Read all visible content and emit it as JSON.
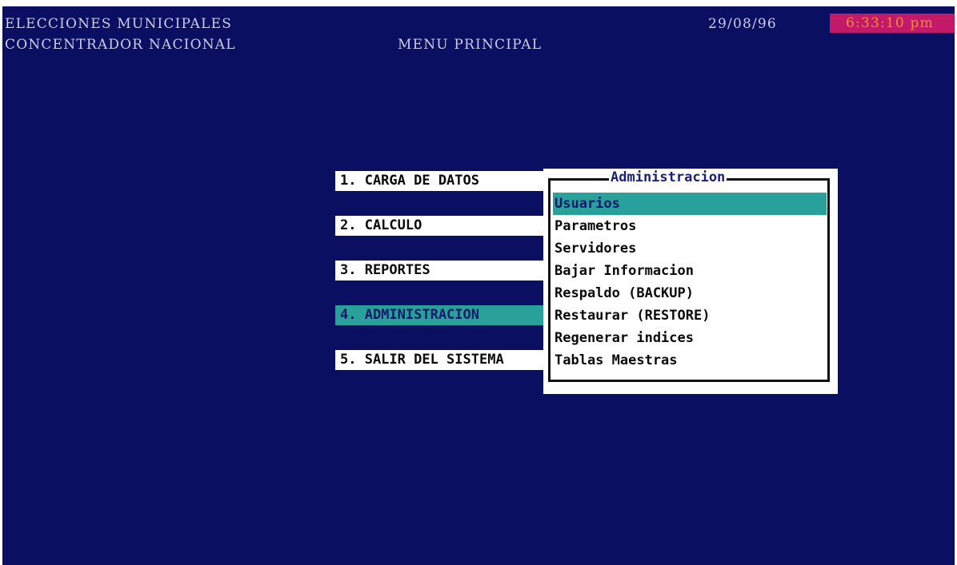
{
  "header": {
    "app_title": "ELECCIONES MUNICIPALES",
    "app_subtitle": "CONCENTRADOR NACIONAL",
    "menu_title": "MENU PRINCIPAL",
    "date": "29/08/96",
    "time": "6:33:10 pm"
  },
  "main_menu": {
    "selected_index": 3,
    "items": [
      {
        "label": "1. CARGA DE DATOS"
      },
      {
        "label": "2. CALCULO"
      },
      {
        "label": "3. REPORTES"
      },
      {
        "label": "4. ADMINISTRACION"
      },
      {
        "label": "5. SALIR DEL SISTEMA"
      }
    ]
  },
  "submenu": {
    "title": "Administracion",
    "selected_index": 0,
    "items": [
      {
        "label": "Usuarios"
      },
      {
        "label": "Parametros"
      },
      {
        "label": "Servidores"
      },
      {
        "label": "Bajar Informacion"
      },
      {
        "label": "Respaldo (BACKUP)"
      },
      {
        "label": "Restaurar (RESTORE)"
      },
      {
        "label": "Regenerar indices"
      },
      {
        "label": "Tablas Maestras"
      }
    ]
  },
  "colors": {
    "background": "#0a0f62",
    "highlight": "#2aa09a",
    "clock_bg": "#c21a68",
    "clock_text": "#f08a3c",
    "header_text": "#c9cde8"
  }
}
